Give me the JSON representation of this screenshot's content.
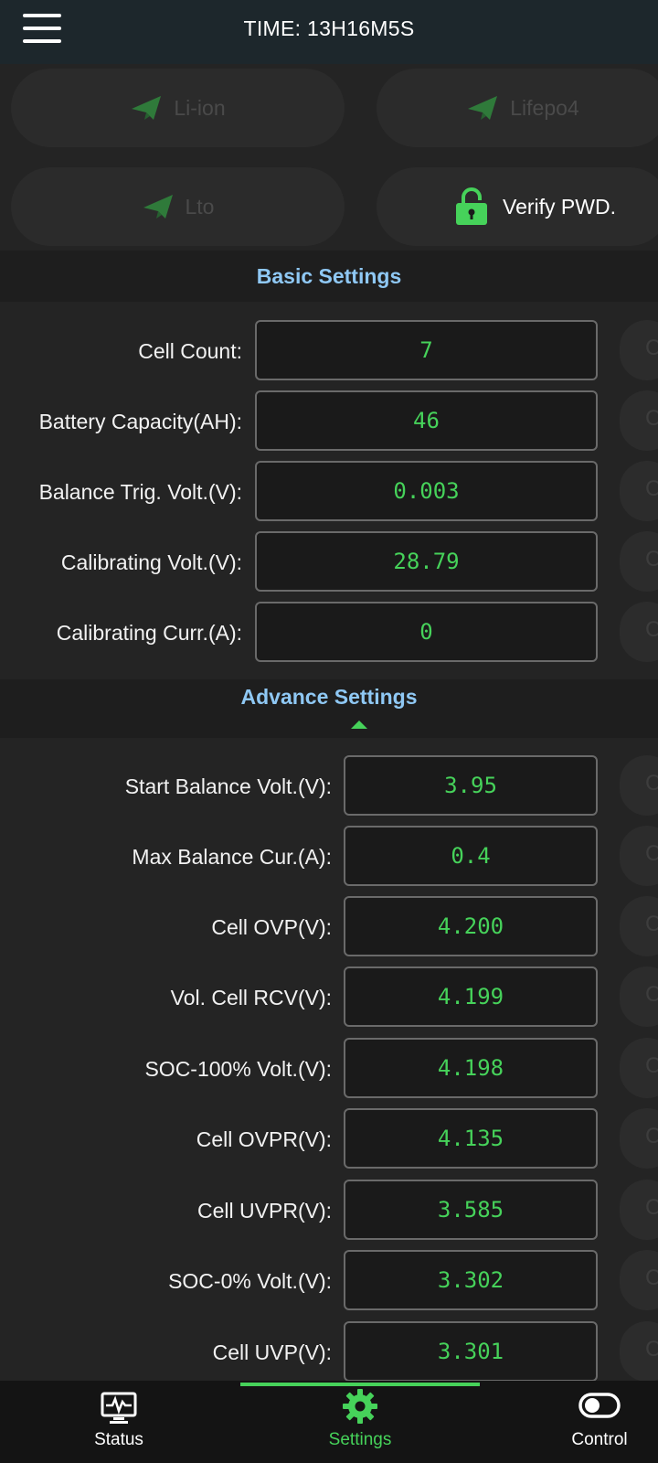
{
  "header": {
    "title": "TIME: 13H16M5S"
  },
  "battery_types": [
    {
      "label": "Li-ion"
    },
    {
      "label": "Lifepo4"
    },
    {
      "label": "Lto"
    }
  ],
  "verify": {
    "label": "Verify PWD."
  },
  "basic": {
    "title": "Basic Settings",
    "rows": [
      {
        "label": "Cell Count:",
        "value": "7"
      },
      {
        "label": "Battery Capacity(AH):",
        "value": "46"
      },
      {
        "label": "Balance Trig. Volt.(V):",
        "value": "0.003"
      },
      {
        "label": "Calibrating Volt.(V):",
        "value": "28.79"
      },
      {
        "label": "Calibrating Curr.(A):",
        "value": "0"
      }
    ]
  },
  "advance": {
    "title": "Advance Settings",
    "rows": [
      {
        "label": "Start Balance Volt.(V):",
        "value": "3.95"
      },
      {
        "label": "Max Balance Cur.(A):",
        "value": "0.4"
      },
      {
        "label": "Cell OVP(V):",
        "value": "4.200"
      },
      {
        "label": "Vol. Cell RCV(V):",
        "value": "4.199"
      },
      {
        "label": "SOC-100% Volt.(V):",
        "value": "4.198"
      },
      {
        "label": "Cell OVPR(V):",
        "value": "4.135"
      },
      {
        "label": "Cell UVPR(V):",
        "value": "3.585"
      },
      {
        "label": "SOC-0% Volt.(V):",
        "value": "3.302"
      },
      {
        "label": "Cell UVP(V):",
        "value": "3.301"
      }
    ]
  },
  "side_button_glyph": "C",
  "nav": [
    {
      "label": "Status",
      "icon": "monitor-pulse-icon"
    },
    {
      "label": "Settings",
      "icon": "gear-icon",
      "active": true
    },
    {
      "label": "Control",
      "icon": "toggle-icon"
    }
  ],
  "colors": {
    "accent": "#46d25a",
    "section_title": "#8fc8f4",
    "topbar": "#1d272c"
  }
}
